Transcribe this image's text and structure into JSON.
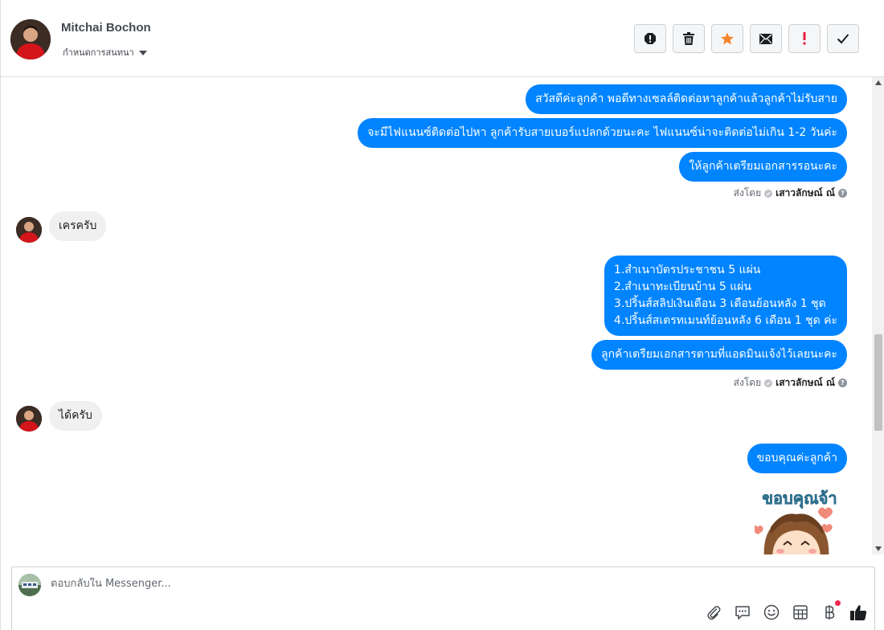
{
  "header": {
    "contact_name": "Mitchai Bochon",
    "subtitle": "กำหนดการสนทนา",
    "actions": [
      {
        "name": "report-icon"
      },
      {
        "name": "trash-icon"
      },
      {
        "name": "star-icon",
        "color": "#f5832a"
      },
      {
        "name": "envelope-icon"
      },
      {
        "name": "exclamation-icon",
        "color": "#e41e3f"
      },
      {
        "name": "check-icon"
      }
    ]
  },
  "messages": {
    "out1": "สวัสดีค่ะลูกค้า พอดีทางเซลล์ติดต่อหาลูกค้าแล้วลูกค้าไม่รับสาย",
    "out2": "จะมีไฟแนนซ์ติดต่อไปหา ลูกค้ารับสายเบอร์แปลกด้วยนะคะ ไฟแนนซ์น่าจะติดต่อไม่เกิน 1-2 วันค่ะ",
    "out3": "ให้ลูกค้าเตรียมเอกสารรอนะคะ",
    "sent_by_1": {
      "prefix": "ส่งโดย",
      "agent": "เสาวลักษณ์ ณ์"
    },
    "in1": "เครครับ",
    "out4": "1.สำเนาบัตรประชาชน 5 แผ่น\n2.สำเนาทะเบียนบ้าน 5 แผ่น\n3.ปริ้นส์สลิปเงินเดือน 3 เดือนย้อนหลัง 1 ชุด\n4.ปริ้นส์สเตรทเมนท์ย้อนหลัง 6 เดือน 1 ชุด ค่ะ",
    "out5": "ลูกค้าเตรียมเอกสารตามที่แอดมินแจ้งไว้เลยนะคะ",
    "sent_by_2": {
      "prefix": "ส่งโดย",
      "agent": "เสาวลักษณ์ ณ์"
    },
    "in2": "ได้ครับ",
    "out6": "ขอบคุณค่ะลูกค้า",
    "sticker_text": "ขอบคุณจ้า"
  },
  "composer": {
    "placeholder": "ตอบกลับใน Messenger...",
    "tools": [
      "paperclip-icon",
      "speech-bubble-icon",
      "smiley-icon",
      "table-icon",
      "baht-icon",
      "thumbs-up-icon"
    ],
    "accent": "#0084ff"
  }
}
